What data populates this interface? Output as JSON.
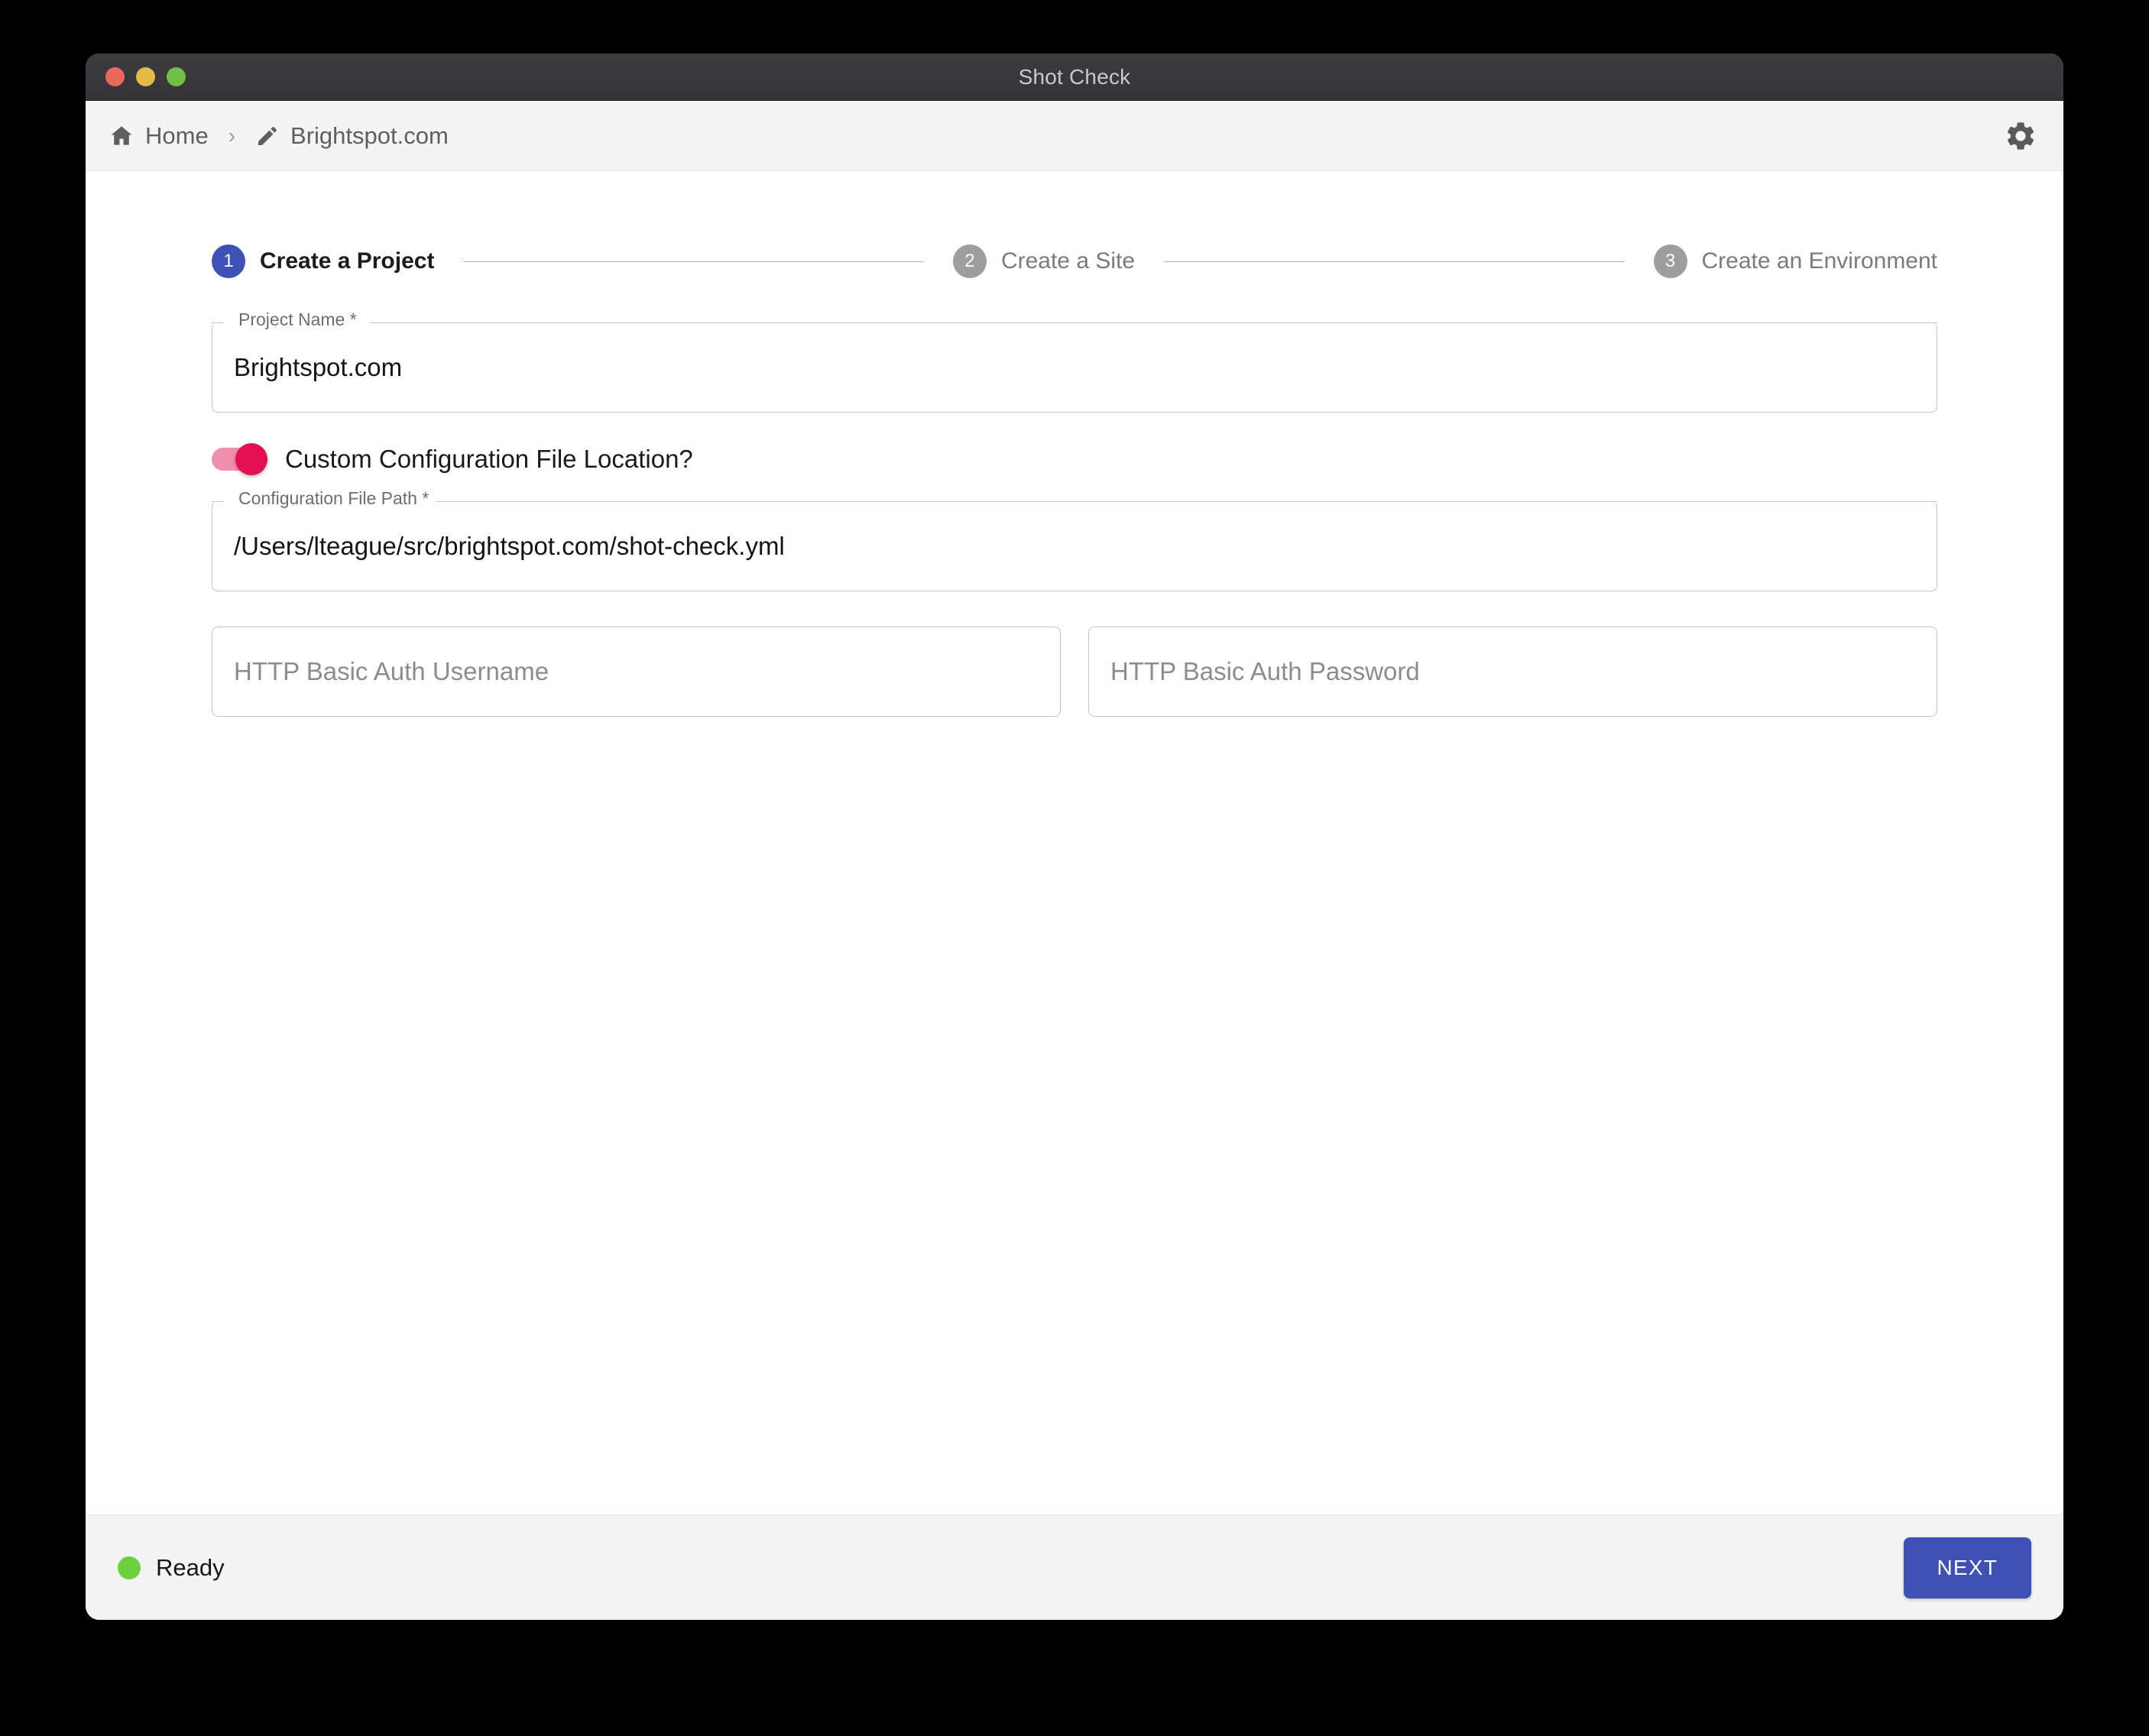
{
  "window": {
    "title": "Shot Check",
    "traffic_lights": [
      "close-red",
      "minimize-yellow",
      "maximize-green"
    ]
  },
  "header": {
    "breadcrumb": [
      {
        "icon": "home-icon",
        "label": "Home"
      },
      {
        "icon": "pencil-icon",
        "label": "Brightspot.com"
      }
    ],
    "separator": "›",
    "settings_icon": "gear-icon"
  },
  "stepper": {
    "active_index": 0,
    "active_color": "#3f51b5",
    "inactive_color": "#9e9e9e",
    "steps": [
      {
        "number": "1",
        "label": "Create a Project"
      },
      {
        "number": "2",
        "label": "Create a Site"
      },
      {
        "number": "3",
        "label": "Create an Environment"
      }
    ]
  },
  "form": {
    "project_name": {
      "label": "Project Name *",
      "value": "Brightspot.com",
      "placeholder": ""
    },
    "custom_config_toggle": {
      "label": "Custom Configuration File Location?",
      "checked": true,
      "track_color": "#f08fab",
      "thumb_color": "#e4104f"
    },
    "config_file_path": {
      "label": "Configuration File Path *",
      "value": "/Users/lteague/src/brightspot.com/shot-check.yml",
      "placeholder": ""
    },
    "auth_username": {
      "label": "",
      "value": "",
      "placeholder": "HTTP Basic Auth Username"
    },
    "auth_password": {
      "label": "",
      "value": "",
      "placeholder": "HTTP Basic Auth Password"
    }
  },
  "footer": {
    "status_text": "Ready",
    "status_color": "#6fd03f",
    "next_label": "NEXT",
    "next_color": "#3f51b5"
  }
}
